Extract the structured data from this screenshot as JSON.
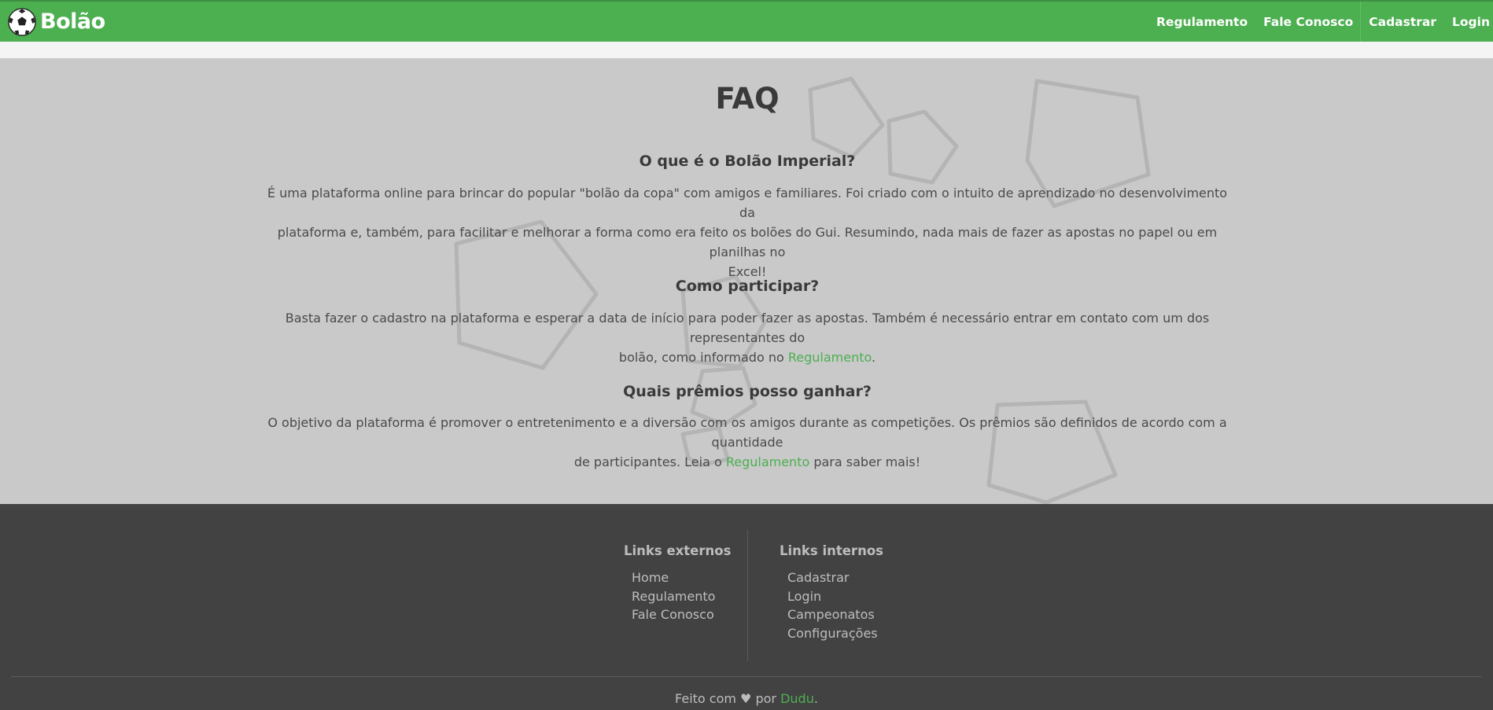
{
  "navbar": {
    "brand": "Bolão",
    "brand_icon": "soccer-ball-icon",
    "links": [
      "Regulamento",
      "Fale Conosco",
      "Cadastrar",
      "Login"
    ],
    "background": "#4caf50"
  },
  "faq": {
    "title": "FAQ",
    "items": [
      {
        "question": "O que é o Bolão Imperial?",
        "answer_lines": [
          "É uma plataforma online para brincar do popular \"bolão da copa\" com amigos e familiares. Foi criado com o intuito de aprendizado no desenvolvimento da",
          "plataforma e, também, para facilitar e melhorar a forma como era feito os bolões do Gui. Resumindo, nada mais de fazer as apostas no papel ou em planilhas no",
          "Excel!"
        ]
      },
      {
        "question": "Como participar?",
        "answer_line1": "Basta fazer o cadastro na plataforma e esperar a data de início para poder fazer as apostas. Também é necessário entrar em contato com um dos representantes do",
        "answer_line2_before": "bolão, como informado no ",
        "answer_line2_link": "Regulamento",
        "answer_line2_after": "."
      },
      {
        "question": "Quais prêmios posso ganhar?",
        "answer_line1": "O objetivo da plataforma é promover o entretenimento e a diversão com os amigos durante as competições. Os prêmios são definidos de acordo com a quantidade",
        "answer_line2_before": "de participantes. Leia o ",
        "answer_line2_link": "Regulamento",
        "answer_line2_after": " para saber mais!"
      }
    ]
  },
  "footer": {
    "external": {
      "title": "Links externos",
      "links": [
        "Home",
        "Regulamento",
        "Fale Conosco"
      ]
    },
    "internal": {
      "title": "Links internos",
      "links": [
        "Cadastrar",
        "Login",
        "Campeonatos",
        "Configurações"
      ]
    },
    "credit_before": "Feito com ♥ por ",
    "credit_link": "Dudu",
    "credit_after": "."
  },
  "colors": {
    "accent": "#4caf50",
    "main_bg": "#c9c9c9",
    "footer_bg": "#424242"
  }
}
